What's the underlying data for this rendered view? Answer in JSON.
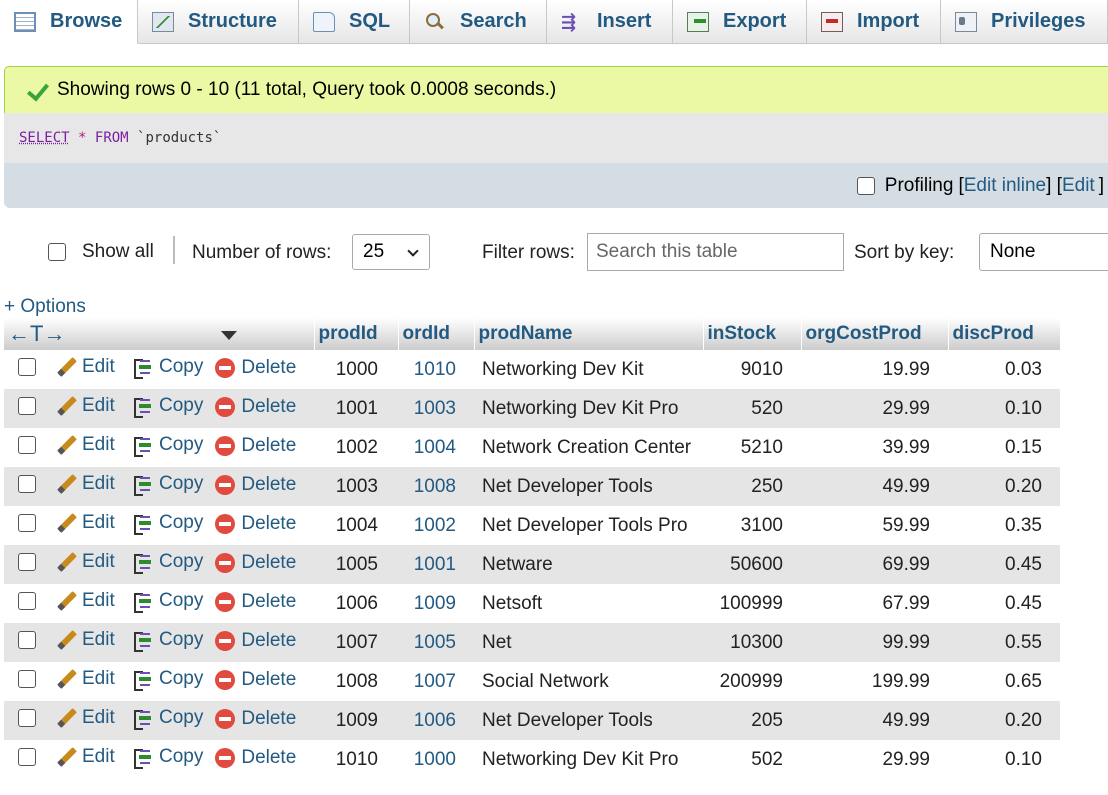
{
  "tabs": [
    {
      "label": "Browse",
      "icon": "browse-icon",
      "active": true
    },
    {
      "label": "Structure",
      "icon": "structure-icon"
    },
    {
      "label": "SQL",
      "icon": "sql-icon"
    },
    {
      "label": "Search",
      "icon": "search-icon"
    },
    {
      "label": "Insert",
      "icon": "insert-icon"
    },
    {
      "label": "Export",
      "icon": "export-icon"
    },
    {
      "label": "Import",
      "icon": "import-icon"
    },
    {
      "label": "Privileges",
      "icon": "privileges-icon"
    }
  ],
  "message": {
    "text": "Showing rows 0 - 10 (11 total, Query took 0.0008 seconds.)",
    "icon": "success-check-icon"
  },
  "query": {
    "select": "SELECT",
    "star": "*",
    "from": "FROM",
    "table": "`products`"
  },
  "profiling": {
    "label": "Profiling",
    "open_bracket": "[",
    "edit_inline": "Edit inline",
    "mid_bracket": "] [",
    "edit": "Edit",
    "close_bracket": "]"
  },
  "controls": {
    "show_all": "Show all",
    "rows_label": "Number of rows:",
    "rows_value": "25",
    "filter_label": "Filter rows:",
    "filter_placeholder": "Search this table",
    "sort_label": "Sort by key:",
    "sort_value": "None"
  },
  "options_link": "+ Options",
  "table": {
    "arrows": "←T→",
    "columns": [
      "prodId",
      "ordId",
      "prodName",
      "inStock",
      "orgCostProd",
      "discProd"
    ],
    "actions": {
      "edit": "Edit",
      "copy": "Copy",
      "delete": "Delete"
    },
    "rows": [
      [
        "1000",
        "1010",
        "Networking Dev Kit",
        "9010",
        "19.99",
        "0.03"
      ],
      [
        "1001",
        "1003",
        "Networking Dev Kit Pro",
        "520",
        "29.99",
        "0.10"
      ],
      [
        "1002",
        "1004",
        "Network Creation Center",
        "5210",
        "39.99",
        "0.15"
      ],
      [
        "1003",
        "1008",
        "Net Developer Tools",
        "250",
        "49.99",
        "0.20"
      ],
      [
        "1004",
        "1002",
        "Net Developer Tools Pro",
        "3100",
        "59.99",
        "0.35"
      ],
      [
        "1005",
        "1001",
        "Netware",
        "50600",
        "69.99",
        "0.45"
      ],
      [
        "1006",
        "1009",
        "Netsoft",
        "100999",
        "67.99",
        "0.45"
      ],
      [
        "1007",
        "1005",
        "Net",
        "10300",
        "99.99",
        "0.55"
      ],
      [
        "1008",
        "1007",
        "Social Network",
        "200999",
        "199.99",
        "0.65"
      ],
      [
        "1009",
        "1006",
        "Net Developer Tools",
        "205",
        "49.99",
        "0.20"
      ],
      [
        "1010",
        "1000",
        "Networking Dev Kit Pro",
        "502",
        "29.99",
        "0.10"
      ]
    ]
  },
  "colors": {
    "link": "#235a81",
    "success_bg": "#ebf8a4",
    "row_alt": "#e5e5e5",
    "delete_icon": "#e04a3f"
  }
}
